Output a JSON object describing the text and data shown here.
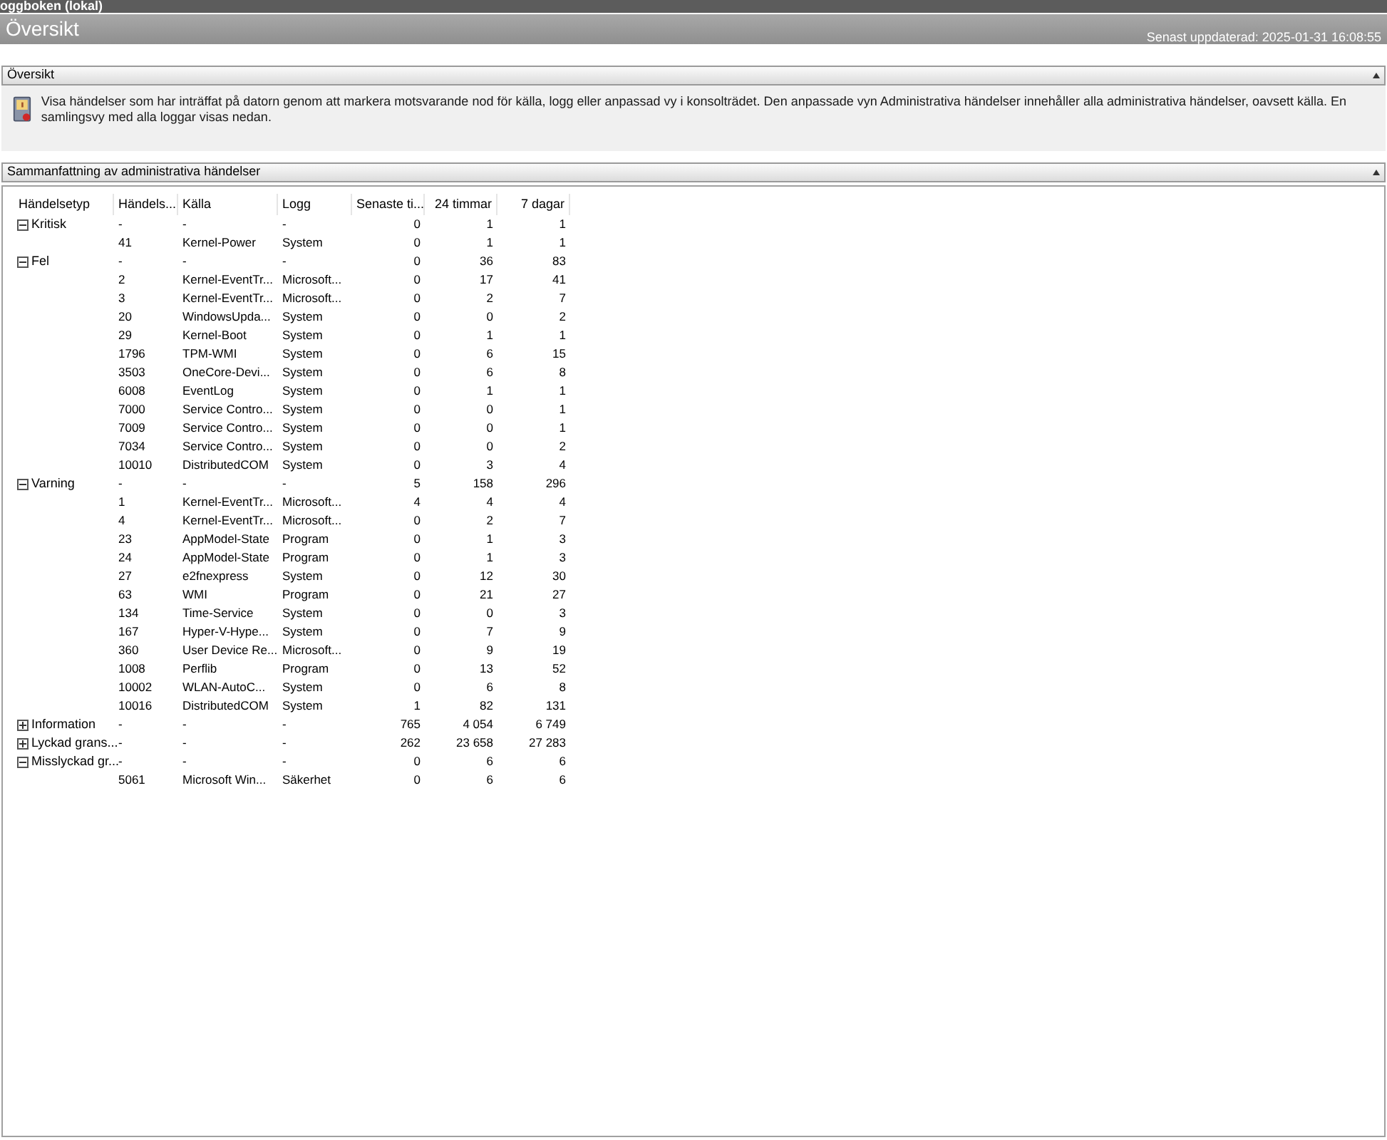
{
  "window": {
    "title": "oggboken (lokal)"
  },
  "header": {
    "title": "Översikt",
    "updated": "Senast uppdaterad: 2025-01-31 16:08:55"
  },
  "overview_section": {
    "title": "Översikt",
    "expanded": true,
    "text": "Visa händelser som har inträffat på datorn genom att markera motsvarande nod för källa, logg eller anpassad vy i konsolträdet. Den anpassade vyn Administrativa händelser innehåller alla administrativa händelser, oavsett källa. En samlingsvy med alla loggar visas nedan."
  },
  "summary_section": {
    "title": "Sammanfattning av administrativa händelser",
    "expanded": true
  },
  "table": {
    "columns": [
      "Händelsetyp",
      "Händels...",
      "Källa",
      "Logg",
      "Senaste ti...",
      "24 timmar",
      "7 dagar"
    ],
    "groups": [
      {
        "type": "Kritisk",
        "expanded": true,
        "cells": [
          "-",
          "-",
          "-",
          "0",
          "1",
          "1"
        ],
        "children": [
          [
            "41",
            "Kernel-Power",
            "System",
            "0",
            "1",
            "1"
          ]
        ]
      },
      {
        "type": "Fel",
        "expanded": true,
        "cells": [
          "-",
          "-",
          "-",
          "0",
          "36",
          "83"
        ],
        "children": [
          [
            "2",
            "Kernel-EventTr...",
            "Microsoft...",
            "0",
            "17",
            "41"
          ],
          [
            "3",
            "Kernel-EventTr...",
            "Microsoft...",
            "0",
            "2",
            "7"
          ],
          [
            "20",
            "WindowsUpda...",
            "System",
            "0",
            "0",
            "2"
          ],
          [
            "29",
            "Kernel-Boot",
            "System",
            "0",
            "1",
            "1"
          ],
          [
            "1796",
            "TPM-WMI",
            "System",
            "0",
            "6",
            "15"
          ],
          [
            "3503",
            "OneCore-Devi...",
            "System",
            "0",
            "6",
            "8"
          ],
          [
            "6008",
            "EventLog",
            "System",
            "0",
            "1",
            "1"
          ],
          [
            "7000",
            "Service Contro...",
            "System",
            "0",
            "0",
            "1"
          ],
          [
            "7009",
            "Service Contro...",
            "System",
            "0",
            "0",
            "1"
          ],
          [
            "7034",
            "Service Contro...",
            "System",
            "0",
            "0",
            "2"
          ],
          [
            "10010",
            "DistributedCOM",
            "System",
            "0",
            "3",
            "4"
          ]
        ]
      },
      {
        "type": "Varning",
        "expanded": true,
        "cells": [
          "-",
          "-",
          "-",
          "5",
          "158",
          "296"
        ],
        "children": [
          [
            "1",
            "Kernel-EventTr...",
            "Microsoft...",
            "4",
            "4",
            "4"
          ],
          [
            "4",
            "Kernel-EventTr...",
            "Microsoft...",
            "0",
            "2",
            "7"
          ],
          [
            "23",
            "AppModel-State",
            "Program",
            "0",
            "1",
            "3"
          ],
          [
            "24",
            "AppModel-State",
            "Program",
            "0",
            "1",
            "3"
          ],
          [
            "27",
            "e2fnexpress",
            "System",
            "0",
            "12",
            "30"
          ],
          [
            "63",
            "WMI",
            "Program",
            "0",
            "21",
            "27"
          ],
          [
            "134",
            "Time-Service",
            "System",
            "0",
            "0",
            "3"
          ],
          [
            "167",
            "Hyper-V-Hype...",
            "System",
            "0",
            "7",
            "9"
          ],
          [
            "360",
            "User Device Re...",
            "Microsoft...",
            "0",
            "9",
            "19"
          ],
          [
            "1008",
            "Perflib",
            "Program",
            "0",
            "13",
            "52"
          ],
          [
            "10002",
            "WLAN-AutoC...",
            "System",
            "0",
            "6",
            "8"
          ],
          [
            "10016",
            "DistributedCOM",
            "System",
            "1",
            "82",
            "131"
          ]
        ]
      },
      {
        "type": "Information",
        "expanded": false,
        "cells": [
          "-",
          "-",
          "-",
          "765",
          "4 054",
          "6 749"
        ]
      },
      {
        "type": "Lyckad grans...",
        "expanded": false,
        "cells": [
          "-",
          "-",
          "-",
          "262",
          "23 658",
          "27 283"
        ]
      },
      {
        "type": "Misslyckad gr...",
        "expanded": true,
        "cells": [
          "-",
          "-",
          "-",
          "0",
          "6",
          "6"
        ],
        "children": [
          [
            "5061",
            "Microsoft Win...",
            "Säkerhet",
            "0",
            "6",
            "6"
          ]
        ]
      }
    ]
  }
}
